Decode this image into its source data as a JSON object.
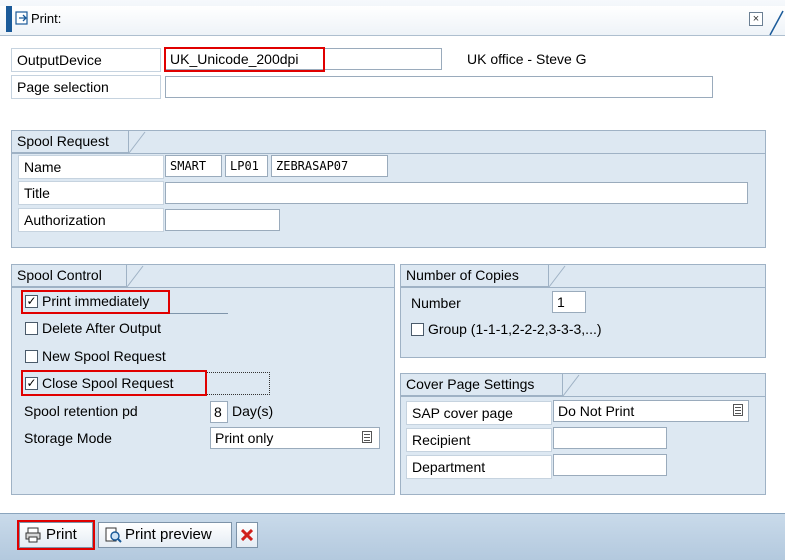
{
  "window": {
    "title": "Print:",
    "close_glyph": "×",
    "icons": {
      "title": "print-dialog-icon",
      "close": "close-icon"
    }
  },
  "output": {
    "output_device_label": "OutputDevice",
    "output_device_value": "UK_Unicode_200dpi",
    "output_device_description": "UK office - Steve G",
    "page_selection_label": "Page selection",
    "page_selection_value": ""
  },
  "spool_request": {
    "heading": "Spool Request",
    "name_label": "Name",
    "name_parts": [
      "SMART",
      "LP01",
      "ZEBRASAP07"
    ],
    "title_label": "Title",
    "title_value": "",
    "authorization_label": "Authorization",
    "authorization_value": ""
  },
  "spool_control": {
    "heading": "Spool Control",
    "print_immediately": {
      "label": "Print immediately",
      "checked": true
    },
    "delete_after_output": {
      "label": "Delete After Output",
      "checked": false
    },
    "new_spool_request": {
      "label": "New Spool Request",
      "checked": false
    },
    "close_spool_request": {
      "label": "Close Spool Request",
      "checked": true
    },
    "retention_label": "Spool retention pd",
    "retention_value": "8",
    "retention_unit": "Day(s)",
    "storage_mode_label": "Storage Mode",
    "storage_mode_value": "Print only"
  },
  "copies": {
    "heading": "Number of Copies",
    "number_label": "Number",
    "number_value": "1",
    "group_label": "Group (1-1-1,2-2-2,3-3-3,...)",
    "group_checked": false
  },
  "cover_page": {
    "heading": "Cover Page Settings",
    "sap_cover_page_label": "SAP cover page",
    "sap_cover_page_value": "Do Not Print",
    "recipient_label": "Recipient",
    "recipient_value": "",
    "department_label": "Department",
    "department_value": ""
  },
  "toolbar": {
    "print_label": "Print",
    "print_preview_label": "Print preview",
    "icons": {
      "print": "printer-icon",
      "preview": "print-preview-icon",
      "cancel": "cancel-icon"
    }
  },
  "colors": {
    "title_accent": "#1a5a99",
    "group_background": "#dde8f2",
    "highlight_red": "#e00000",
    "toolbar_background": "#b3c9de"
  }
}
